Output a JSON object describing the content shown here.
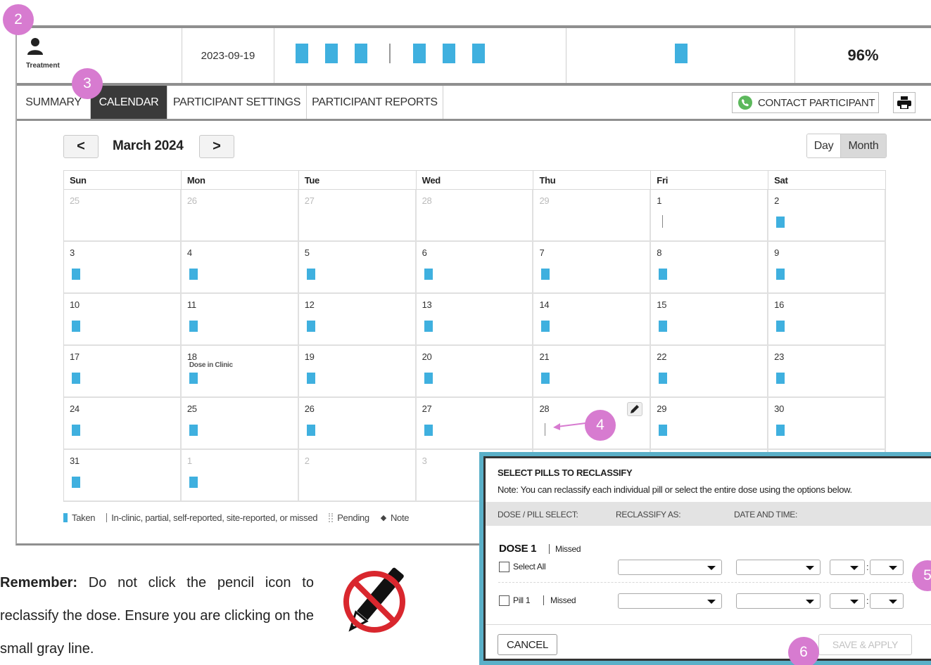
{
  "header": {
    "treatment_label": "Treatment",
    "date": "2023-09-19",
    "adherence": "96%"
  },
  "tabs": [
    {
      "label": "SUMMARY"
    },
    {
      "label": "CALENDAR",
      "active": true
    },
    {
      "label": "PARTICIPANT SETTINGS"
    },
    {
      "label": "PARTICIPANT REPORTS"
    }
  ],
  "contact_label": "CONTACT PARTICIPANT",
  "calendar": {
    "month_title": "March 2024",
    "prev": "<",
    "next": ">",
    "view_day": "Day",
    "view_month": "Month",
    "weekdays": [
      "Sun",
      "Mon",
      "Tue",
      "Wed",
      "Thu",
      "Fri",
      "Sat"
    ],
    "weeks": [
      [
        {
          "day": "25",
          "other": true
        },
        {
          "day": "26",
          "other": true
        },
        {
          "day": "27",
          "other": true
        },
        {
          "day": "28",
          "other": true
        },
        {
          "day": "29",
          "other": true
        },
        {
          "day": "1",
          "mark": "partial"
        },
        {
          "day": "2",
          "mark": "taken"
        }
      ],
      [
        {
          "day": "3",
          "mark": "taken"
        },
        {
          "day": "4",
          "mark": "taken"
        },
        {
          "day": "5",
          "mark": "taken"
        },
        {
          "day": "6",
          "mark": "taken"
        },
        {
          "day": "7",
          "mark": "taken"
        },
        {
          "day": "8",
          "mark": "taken"
        },
        {
          "day": "9",
          "mark": "taken"
        }
      ],
      [
        {
          "day": "10",
          "mark": "taken"
        },
        {
          "day": "11",
          "mark": "taken"
        },
        {
          "day": "12",
          "mark": "taken"
        },
        {
          "day": "13",
          "mark": "taken"
        },
        {
          "day": "14",
          "mark": "taken"
        },
        {
          "day": "15",
          "mark": "taken"
        },
        {
          "day": "16",
          "mark": "taken"
        }
      ],
      [
        {
          "day": "17",
          "mark": "taken"
        },
        {
          "day": "18",
          "mark": "taken",
          "note": "Dose in Clinic"
        },
        {
          "day": "19",
          "mark": "taken"
        },
        {
          "day": "20",
          "mark": "taken"
        },
        {
          "day": "21",
          "mark": "taken"
        },
        {
          "day": "22",
          "mark": "taken"
        },
        {
          "day": "23",
          "mark": "taken"
        }
      ],
      [
        {
          "day": "24",
          "mark": "taken"
        },
        {
          "day": "25",
          "mark": "taken"
        },
        {
          "day": "26",
          "mark": "taken"
        },
        {
          "day": "27",
          "mark": "taken"
        },
        {
          "day": "28",
          "mark": "partial",
          "pencil": true
        },
        {
          "day": "29",
          "mark": "taken"
        },
        {
          "day": "30",
          "mark": "taken"
        }
      ],
      [
        {
          "day": "31",
          "mark": "taken"
        },
        {
          "day": "1",
          "other": true,
          "mark": "taken"
        },
        {
          "day": "2",
          "other": true
        },
        {
          "day": "3",
          "other": true
        },
        {
          "day": "",
          "other": true
        },
        {
          "day": "",
          "other": true
        },
        {
          "day": "",
          "other": true
        }
      ]
    ]
  },
  "legend": {
    "taken": "Taken",
    "partial": "In-clinic, partial, self-reported, site-reported, or missed",
    "pending": "Pending",
    "note": "Note"
  },
  "reminder": {
    "bold": "Remember:",
    "text": " Do not click the pencil icon to reclassify the dose. Ensure you are clicking on the small gray line."
  },
  "modal": {
    "title": "SELECT PILLS TO RECLASSIFY",
    "note": "Note: You can reclassify each individual pill or select the entire dose using the options below.",
    "col_dose": "DOSE / PILL SELECT:",
    "col_reclassify": "RECLASSIFY AS:",
    "col_datetime": "DATE AND TIME:",
    "dose_title": "DOSE 1",
    "dose_status": "Missed",
    "select_all": "Select All",
    "pill_label": "Pill 1",
    "pill_status": "Missed",
    "colon": ":",
    "cancel": "CANCEL",
    "save": "SAVE & APPLY"
  },
  "callouts": [
    "2",
    "3",
    "4",
    "5",
    "6"
  ],
  "colors": {
    "taken": "#3fb0df",
    "callout": "#d77bd0",
    "modal_border": "#5ab0c8",
    "active_tab": "#3a3a3a"
  }
}
